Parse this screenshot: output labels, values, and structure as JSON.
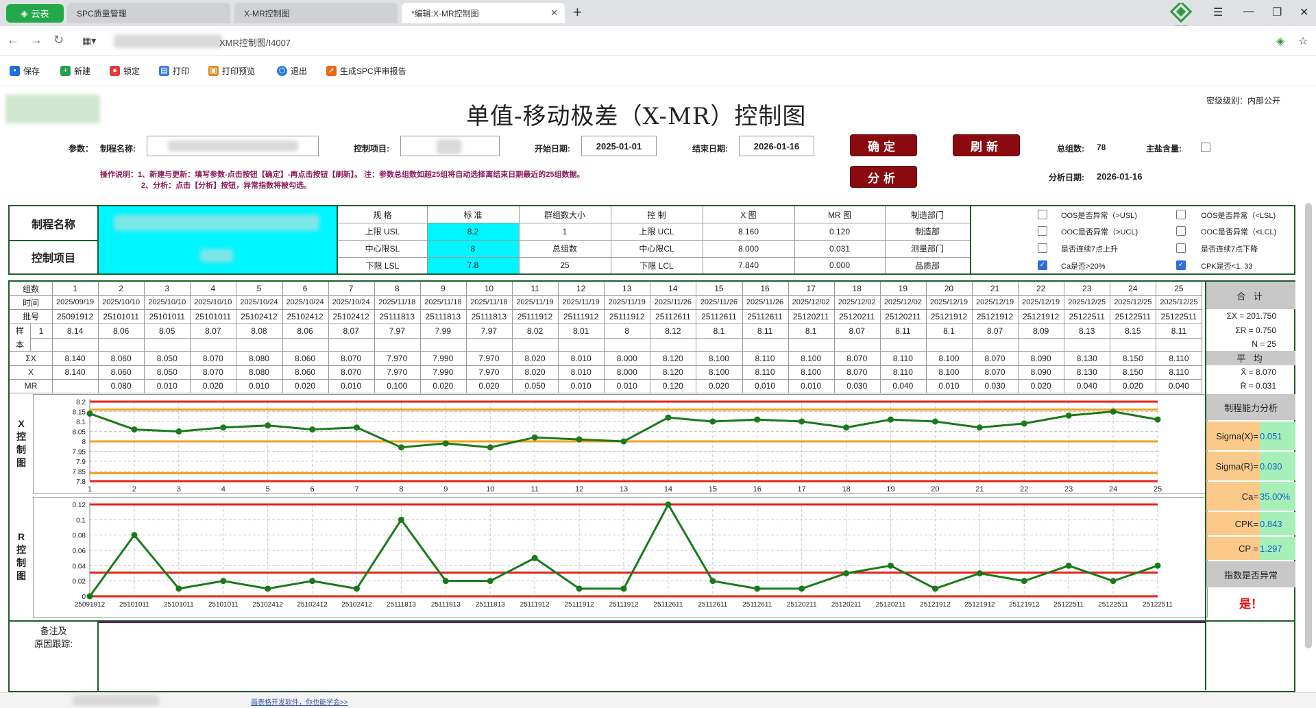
{
  "browser": {
    "app_tab_label": "云表",
    "tabs": [
      {
        "label": "SPC质量管理"
      },
      {
        "label": "X-MR控制图"
      },
      {
        "label": "*编辑:X-MR控制图"
      }
    ],
    "url_fragment": "XMR控制图/I4007"
  },
  "toolbar": {
    "items": [
      {
        "label": "保存",
        "icon": "save-icon",
        "color": "#1e6fd9"
      },
      {
        "label": "新建",
        "icon": "plus-icon",
        "color": "#21a14a"
      },
      {
        "label": "锁定",
        "icon": "lock-icon",
        "color": "#e23b3b"
      },
      {
        "label": "打印",
        "icon": "printer-icon",
        "color": "#3d7bd8"
      },
      {
        "label": "打印预览",
        "icon": "preview-icon",
        "color": "#e08a1a"
      },
      {
        "label": "退出",
        "icon": "power-icon",
        "color": "#2a7ad9"
      },
      {
        "label": "生成SPC评审报告",
        "icon": "rocket-icon",
        "color": "#e86a1a"
      }
    ]
  },
  "header": {
    "title": "单值-移动极差（X-MR）控制图",
    "security_level": "密级级别：内部公开",
    "param_label": "参数：",
    "process_name_label": "制程名称:",
    "control_item_label": "控制项目:",
    "start_date_label": "开始日期:",
    "start_date": "2025-01-01",
    "end_date_label": "结束日期:",
    "end_date": "2026-01-16",
    "confirm_button": "确定",
    "refresh_button": "刷新",
    "analyze_button": "分析",
    "total_groups_label": "总组数:",
    "total_groups": "78",
    "main_salt_label": "主盐含量:",
    "analysis_date_label": "分析日期:",
    "analysis_date": "2026-01-16",
    "instruction_1": "操作说明：1、新建与更新：填写参数-点击按钮【确定】-再点击按钮【刷新】。 注：参数总组数如超25组将自动选择离结束日期最近的25组数据。",
    "instruction_2": "2、分析：点击【分析】按钮，异常指数将被勾选。"
  },
  "spec_table": {
    "process_name_label": "制程名称",
    "control_item_label": "控制项目",
    "col_headers": [
      "规 格",
      "标 准",
      "群组数大小",
      "控 制",
      "X 图",
      "MR 图",
      "制造部门"
    ],
    "rows": [
      [
        "上限 USL",
        "8.2",
        "1",
        "上限 UCL",
        "8.160",
        "0.120",
        "制造部"
      ],
      [
        "中心限SL",
        "8",
        "总组数",
        "中心限CL",
        "8.000",
        "0.031",
        "测量部门"
      ],
      [
        "下限 LSL",
        "7.8",
        "25",
        "下限 LCL",
        "7.840",
        "0.000",
        "品质部"
      ]
    ],
    "checks": [
      {
        "label": "OOS是否异常（>USL)",
        "checked": false
      },
      {
        "label": "OOS是否异常（<LSL)",
        "checked": false
      },
      {
        "label": "OOC是否异常（>UCL)",
        "checked": false
      },
      {
        "label": "OOC是否异常（<LCL)",
        "checked": false
      },
      {
        "label": "是否连续7点上升",
        "checked": false
      },
      {
        "label": "是否连续7点下降",
        "checked": false
      },
      {
        "label": "Ca是否>20%",
        "checked": true
      },
      {
        "label": "CPK是否<1. 33",
        "checked": true
      }
    ]
  },
  "data_table": {
    "row_labels": {
      "group": "组数",
      "time": "时间",
      "batch": "批号",
      "sample_1": "样",
      "sample_2": "本",
      "sample_index": "1",
      "sum_x": "ΣX",
      "x": "X",
      "mr": "MR"
    },
    "groups": [
      "1",
      "2",
      "3",
      "4",
      "5",
      "6",
      "7",
      "8",
      "9",
      "10",
      "11",
      "12",
      "13",
      "14",
      "15",
      "16",
      "17",
      "18",
      "19",
      "20",
      "21",
      "22",
      "23",
      "24",
      "25"
    ],
    "times": [
      "2025/09/19",
      "2025/10/10",
      "2025/10/10",
      "2025/10/10",
      "2025/10/24",
      "2025/10/24",
      "2025/10/24",
      "2025/11/18",
      "2025/11/18",
      "2025/11/18",
      "2025/11/19",
      "2025/11/19",
      "2025/11/19",
      "2025/11/26",
      "2025/11/26",
      "2025/11/26",
      "2025/12/02",
      "2025/12/02",
      "2025/12/02",
      "2025/12/19",
      "2025/12/19",
      "2025/12/19",
      "2025/12/25",
      "2025/12/25",
      "2025/12/25"
    ],
    "batches": [
      "25091912",
      "25101011",
      "25101011",
      "25101011",
      "25102412",
      "25102412",
      "25102412",
      "25111813",
      "25111813",
      "25111813",
      "25111912",
      "25111912",
      "25111912",
      "25112611",
      "25112611",
      "25112611",
      "25120211",
      "25120211",
      "25120211",
      "25121912",
      "25121912",
      "25121912",
      "25122511",
      "25122511",
      "25122511"
    ],
    "samples": [
      "8.14",
      "8.06",
      "8.05",
      "8.07",
      "8.08",
      "8.06",
      "8.07",
      "7.97",
      "7.99",
      "7.97",
      "8.02",
      "8.01",
      "8",
      "8.12",
      "8.1",
      "8.11",
      "8.1",
      "8.07",
      "8.11",
      "8.1",
      "8.07",
      "8.09",
      "8.13",
      "8.15",
      "8.11"
    ],
    "sum_x": [
      "8.140",
      "8.060",
      "8.050",
      "8.070",
      "8.080",
      "8.060",
      "8.070",
      "7.970",
      "7.990",
      "7.970",
      "8.020",
      "8.010",
      "8.000",
      "8.120",
      "8.100",
      "8.110",
      "8.100",
      "8.070",
      "8.110",
      "8.100",
      "8.070",
      "8.090",
      "8.130",
      "8.150",
      "8.110"
    ],
    "x": [
      "8.140",
      "8.060",
      "8.050",
      "8.070",
      "8.080",
      "8.060",
      "8.070",
      "7.970",
      "7.990",
      "7.970",
      "8.020",
      "8.010",
      "8.000",
      "8.120",
      "8.100",
      "8.110",
      "8.100",
      "8.070",
      "8.110",
      "8.100",
      "8.070",
      "8.090",
      "8.130",
      "8.150",
      "8.110"
    ],
    "mr": [
      "",
      "0.080",
      "0.010",
      "0.020",
      "0.010",
      "0.020",
      "0.010",
      "0.100",
      "0.020",
      "0.020",
      "0.050",
      "0.010",
      "0.010",
      "0.120",
      "0.020",
      "0.010",
      "0.010",
      "0.030",
      "0.040",
      "0.010",
      "0.030",
      "0.020",
      "0.040",
      "0.020",
      "0.040"
    ]
  },
  "summary": {
    "total_label": "合 计",
    "sum_x": "ΣX = 201.750",
    "sum_r": "ΣR = 0.750",
    "n": "N = 25",
    "average_label": "平 均",
    "x_bar": "X̄ = 8.070",
    "r_bar": "R̄ = 0.031",
    "capability_label": "制程能力分析",
    "capability": [
      {
        "label": "Sigma(X)=",
        "value": "0.051"
      },
      {
        "label": "Sigma(R)=",
        "value": "0.030"
      },
      {
        "label": "Ca=",
        "value": "35.00%"
      },
      {
        "label": "CPK=",
        "value": "0.843"
      },
      {
        "label": "CP =",
        "value": "1.297"
      }
    ],
    "abnormal_label": "指数是否异常",
    "abnormal_value": "是！"
  },
  "x_chart_label": "X控制图",
  "r_chart_label": "R控制图",
  "remarks_label_1": "备注及",
  "remarks_label_2": "原因跟踪:",
  "status_link": "画表格开发软件，你也能学会>>",
  "chart_data": [
    {
      "type": "line",
      "x": [
        1,
        2,
        3,
        4,
        5,
        6,
        7,
        8,
        9,
        10,
        11,
        12,
        13,
        14,
        15,
        16,
        17,
        18,
        19,
        20,
        21,
        22,
        23,
        24,
        25
      ],
      "series": [
        {
          "values": [
            8.14,
            8.06,
            8.05,
            8.07,
            8.08,
            8.06,
            8.07,
            7.97,
            7.99,
            7.97,
            8.02,
            8.01,
            8.0,
            8.12,
            8.1,
            8.11,
            8.1,
            8.07,
            8.11,
            8.1,
            8.07,
            8.09,
            8.13,
            8.15,
            8.11
          ]
        }
      ],
      "reference_lines": {
        "usl": 8.2,
        "ucl": 8.16,
        "cl": 8.0,
        "lcl": 7.84,
        "lsl": 7.8
      },
      "yticks": [
        "8.2",
        "8.15",
        "8.1",
        "8.05",
        "8",
        "7.95",
        "7.9",
        "7.85",
        "7.8"
      ],
      "ylim": [
        7.8,
        8.2
      ],
      "grid": true,
      "series_color": "#1a7a1a",
      "spec_color": "#e8231a",
      "control_color": "#f0a020"
    },
    {
      "type": "line",
      "x": [
        "25091912",
        "25101011",
        "25101011",
        "25101011",
        "25102412",
        "25102412",
        "25102412",
        "25111813",
        "25111813",
        "25111813",
        "25111912",
        "25111912",
        "25111912",
        "25112611",
        "25112611",
        "25112611",
        "25120211",
        "25120211",
        "25120211",
        "25121912",
        "25121912",
        "25121912",
        "25122511",
        "25122511",
        "25122511"
      ],
      "series": [
        {
          "values": [
            0,
            0.08,
            0.01,
            0.02,
            0.01,
            0.02,
            0.01,
            0.1,
            0.02,
            0.02,
            0.05,
            0.01,
            0.01,
            0.12,
            0.02,
            0.01,
            0.01,
            0.03,
            0.04,
            0.01,
            0.03,
            0.02,
            0.04,
            0.02,
            0.04
          ]
        }
      ],
      "reference_lines": {
        "ucl": 0.12,
        "cl": 0.031,
        "lcl": 0.0
      },
      "yticks": [
        "0.12",
        "0.1",
        "0.08",
        "0.06",
        "0.04",
        "0.02",
        "0"
      ],
      "ylim": [
        0,
        0.12
      ],
      "grid": true,
      "series_color": "#1a7a1a",
      "limit_color": "#e8231a"
    }
  ]
}
